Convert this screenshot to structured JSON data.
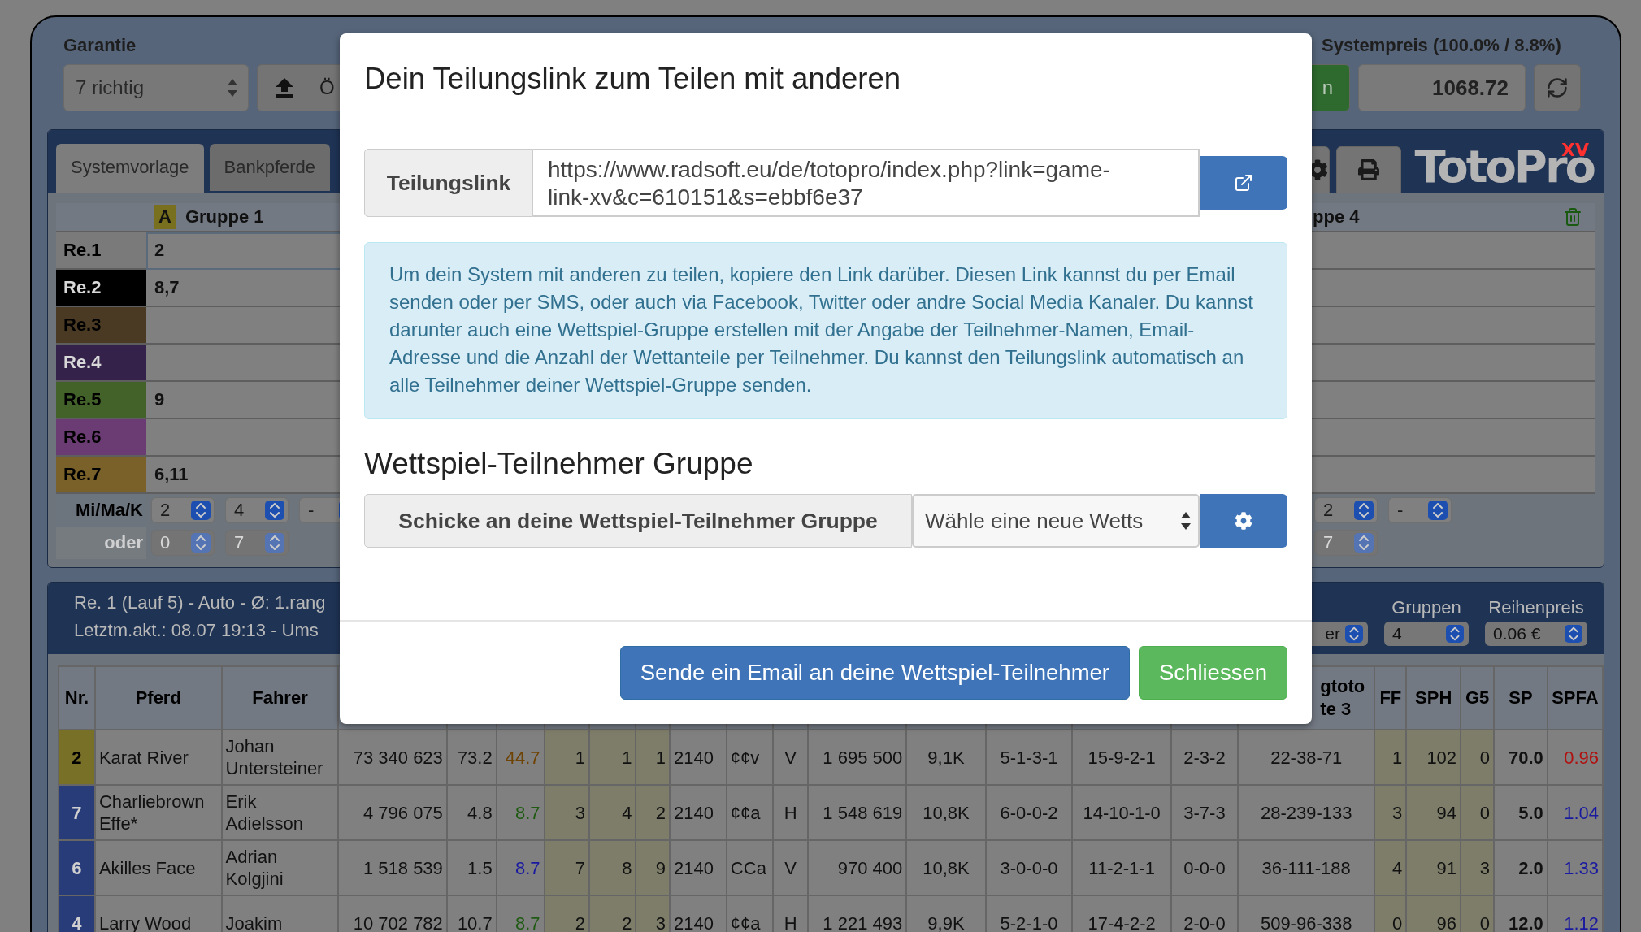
{
  "garantie": {
    "label": "Garantie",
    "value": "7 richtig"
  },
  "open_button": {
    "label": "Ö"
  },
  "systempreis": {
    "label": "Systempreis (100.0% / 8.8%)",
    "value": "1068.72",
    "action": "n"
  },
  "tabs": [
    {
      "label": "Systemvorlage",
      "selected": true
    },
    {
      "label": "Bankpferde",
      "selected": false
    }
  ],
  "logo": {
    "text": "TotoPro",
    "badge": "XV"
  },
  "groups": [
    {
      "badge": "A",
      "title": "Gruppe 1"
    },
    {
      "title": "ppe 4"
    }
  ],
  "rows": [
    {
      "label": "Re.1",
      "color": "#7a7a7a",
      "value": "2"
    },
    {
      "label": "Re.2",
      "color": "#000000",
      "value": "8,7"
    },
    {
      "label": "Re.3",
      "color": "#4a3a24"
    },
    {
      "label": "Re.4",
      "color": "#35224b"
    },
    {
      "label": "Re.5",
      "color": "#43622a",
      "value": "9"
    },
    {
      "label": "Re.6",
      "color": "#6b3c73"
    },
    {
      "label": "Re.7",
      "color": "#7a6129",
      "value": "6,11"
    }
  ],
  "limits": [
    {
      "label": "Mi/Ma/K",
      "disabled": false,
      "group_1": [
        "2",
        "4",
        "-"
      ],
      "group_4": [
        "2",
        "-"
      ]
    },
    {
      "label": "oder",
      "disabled": true,
      "group_1": [
        "0",
        "7"
      ],
      "group_4": [
        "7"
      ]
    }
  ],
  "race_panel": {
    "lines": [
      "Re. 1 (Lauf 5) - Auto - Ø: 1.rang",
      "Letztm.akt.: 08.07 19:13 - Ums"
    ],
    "filter": "er",
    "gruppen": {
      "label": "Gruppen",
      "value": "4"
    },
    "reihenpreis": {
      "label": "Reihenpreis",
      "value": "0.06 €"
    }
  },
  "table": {
    "columns": [
      {
        "label": "Nr."
      },
      {
        "label": "Pferd"
      },
      {
        "label": "Fahrer"
      },
      {},
      {},
      {},
      {},
      {},
      {},
      {},
      {},
      {},
      {},
      {},
      {},
      {},
      {},
      {
        "lines": [
          "gtoto",
          "te 3"
        ]
      },
      {
        "label": "FF"
      },
      {
        "label": "SPH"
      },
      {
        "label": "G5"
      },
      {
        "label": "SP"
      },
      {
        "label": "SPFA"
      }
    ],
    "rows": [
      {
        "color": "#797028",
        "cells": [
          "2",
          "Karat River",
          "Johan Untersteiner",
          "73 340 623",
          "73.2",
          {
            "text": "44.7",
            "color": "#6e4200"
          },
          "1",
          "1",
          "1",
          "2140",
          "¢¢v",
          "V",
          "1 695 500",
          "9,1K",
          "5-1-3-1",
          "15-9-2-1",
          "2-3-2",
          "22-38-71",
          "1",
          "102",
          "0",
          "70.0",
          {
            "text": "0.96",
            "color": "#b01010"
          }
        ]
      },
      {
        "color": "#283c7a",
        "cells": [
          "7",
          "Charliebrown Effe*",
          "Erik Adielsson",
          "4 796 075",
          "4.8",
          {
            "text": "8.7",
            "color": "#1f5a12"
          },
          "3",
          "4",
          "2",
          "2140",
          "¢¢a",
          "H",
          "1 548 619",
          "10,8K",
          "6-0-0-2",
          "14-10-1-0",
          "3-7-3",
          "28-239-133",
          "3",
          "94",
          "0",
          "5.0",
          {
            "text": "1.04",
            "color": "#1a1aa0"
          }
        ]
      },
      {
        "color": "#283c7a",
        "cells": [
          "6",
          "Akilles Face",
          "Adrian Kolgjini",
          "1 518 539",
          "1.5",
          {
            "text": "8.7",
            "color": "#1a1aa0"
          },
          "7",
          "8",
          "9",
          "2140",
          "CCa",
          "V",
          "970 400",
          "10,8K",
          "3-0-0-0",
          "11-2-1-1",
          "0-0-0",
          "36-111-188",
          "4",
          "91",
          "3",
          "2.0",
          {
            "text": "1.33",
            "color": "#1a1aa0"
          }
        ]
      },
      {
        "color": "#283c7a",
        "cells": [
          "4",
          "Larry Wood",
          "Joakim",
          "10 702 782",
          "10.7",
          {
            "text": "8.7",
            "color": "#1f5a12"
          },
          "2",
          "2",
          "3",
          "2140",
          "¢¢a",
          "H",
          "1 221 493",
          "9,9K",
          "5-2-1-0",
          "17-4-2-2",
          "2-0-0",
          "509-96-338",
          "0",
          "96",
          "0",
          "12.0",
          {
            "text": "1.12",
            "color": "#1a1aa0"
          }
        ]
      }
    ]
  },
  "modal": {
    "title": "Dein Teilungslink zum Teilen mit anderen",
    "link_label": "Teilungslink",
    "link": "https://www.radsoft.eu/de/totopro/index.php?link=game-link-xv&c=610151&s=ebbf6e37",
    "info": "Um dein System mit anderen zu teilen, kopiere den Link darüber. Diesen Link kannst du per Email senden oder per SMS, oder auch via Facebook, Twitter oder andre Social Media Kanaler. Du kannst darunter auch eine Wettspiel-Gruppe erstellen mit der Angabe der Teilnehmer-Namen, Email-Adresse und die Anzahl der Wettanteile per Teilnehmer. Du kannst den Teilungslink automatisch an alle Teilnehmer deiner Wettspiel-Gruppe senden.",
    "group_heading": "Wettspiel-Teilnehmer Gruppe",
    "group_label": "Schicke an deine Wettspiel-Teilnehmer Gruppe",
    "group_select": "Wähle eine neue Wetts",
    "buttons": [
      {
        "kind": "primary",
        "label": "Sende ein Email an deine Wettspiel-Teilnehmer"
      },
      {
        "kind": "success",
        "label": "Schliessen"
      }
    ]
  }
}
